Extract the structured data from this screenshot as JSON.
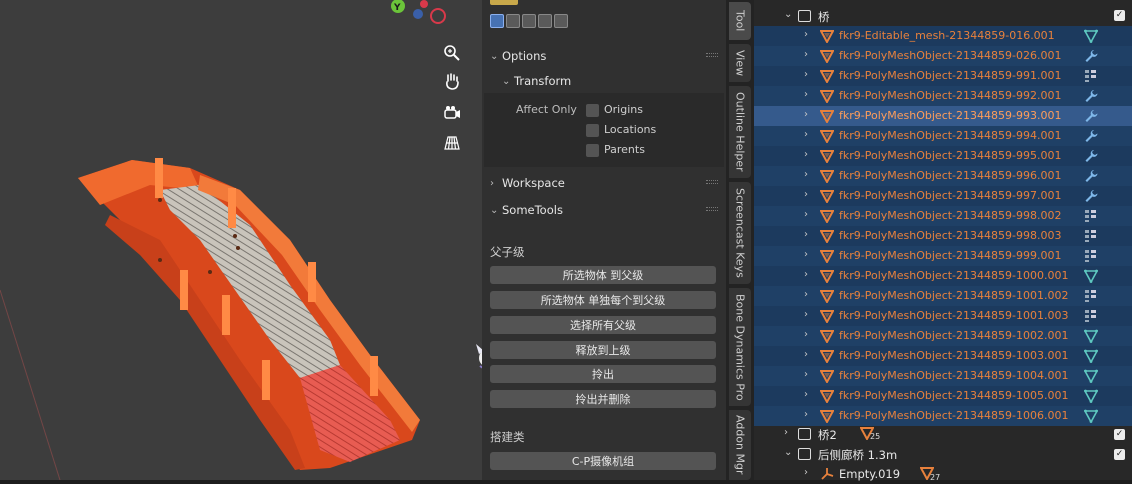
{
  "panel": {
    "options_title": "Options",
    "transform_title": "Transform",
    "affect_only_label": "Affect Only",
    "checkboxes": [
      "Origins",
      "Locations",
      "Parents"
    ],
    "workspace_title": "Workspace",
    "sometools_title": "SomeTools",
    "parent_section_label": "父子级",
    "parent_buttons": [
      "所选物体 到父级",
      "所选物体 单独每个到父级",
      "选择所有父级",
      "释放到上级",
      "拎出",
      "拎出并删除"
    ],
    "build_section_label": "搭建类",
    "build_buttons": [
      "C-P摄像机组"
    ]
  },
  "tabs": [
    "Tool",
    "View",
    "Outline Helper",
    "Screencast Keys",
    "Bone Dynamics Pro",
    "Addon Mgr"
  ],
  "outliner": {
    "collection_name": "桥",
    "objects": [
      {
        "name": "fkr9-Editable_mesh-21344859-016.001",
        "mod": "mesh-data-icon"
      },
      {
        "name": "fkr9-PolyMeshObject-21344859-026.001",
        "mod": "wrench-icon"
      },
      {
        "name": "fkr9-PolyMeshObject-21344859-991.001",
        "mod": "vertex-groups-icon"
      },
      {
        "name": "fkr9-PolyMeshObject-21344859-992.001",
        "mod": "wrench-icon"
      },
      {
        "name": "fkr9-PolyMeshObject-21344859-993.001",
        "mod": "wrench-icon"
      },
      {
        "name": "fkr9-PolyMeshObject-21344859-994.001",
        "mod": "wrench-icon"
      },
      {
        "name": "fkr9-PolyMeshObject-21344859-995.001",
        "mod": "wrench-icon"
      },
      {
        "name": "fkr9-PolyMeshObject-21344859-996.001",
        "mod": "wrench-icon"
      },
      {
        "name": "fkr9-PolyMeshObject-21344859-997.001",
        "mod": "wrench-icon"
      },
      {
        "name": "fkr9-PolyMeshObject-21344859-998.002",
        "mod": "vertex-groups-icon"
      },
      {
        "name": "fkr9-PolyMeshObject-21344859-998.003",
        "mod": "vertex-groups-icon"
      },
      {
        "name": "fkr9-PolyMeshObject-21344859-999.001",
        "mod": "vertex-groups-icon"
      },
      {
        "name": "fkr9-PolyMeshObject-21344859-1000.001",
        "mod": "mesh-data-icon"
      },
      {
        "name": "fkr9-PolyMeshObject-21344859-1001.002",
        "mod": "vertex-groups-icon"
      },
      {
        "name": "fkr9-PolyMeshObject-21344859-1001.003",
        "mod": "vertex-groups-icon"
      },
      {
        "name": "fkr9-PolyMeshObject-21344859-1002.001",
        "mod": "mesh-data-icon"
      },
      {
        "name": "fkr9-PolyMeshObject-21344859-1003.001",
        "mod": "mesh-data-icon"
      },
      {
        "name": "fkr9-PolyMeshObject-21344859-1004.001",
        "mod": "mesh-data-icon"
      },
      {
        "name": "fkr9-PolyMeshObject-21344859-1005.001",
        "mod": "mesh-data-icon"
      },
      {
        "name": "fkr9-PolyMeshObject-21344859-1006.001",
        "mod": "mesh-data-icon"
      }
    ],
    "active_object": "fkr9-PolyMeshObject-21344859-993.001",
    "sub_collections": [
      {
        "name": "桥2",
        "count": "25"
      },
      {
        "name": "后侧廊桥 1.3m"
      }
    ],
    "empty_name": "Empty.019",
    "empty_count": "27"
  },
  "gizmo": {
    "y_label": "Y"
  },
  "colors": {
    "selection": "#1c3a5e",
    "active": "#355a8c",
    "object_text": "#e8813c",
    "mesh_orange": "#e8541f"
  }
}
